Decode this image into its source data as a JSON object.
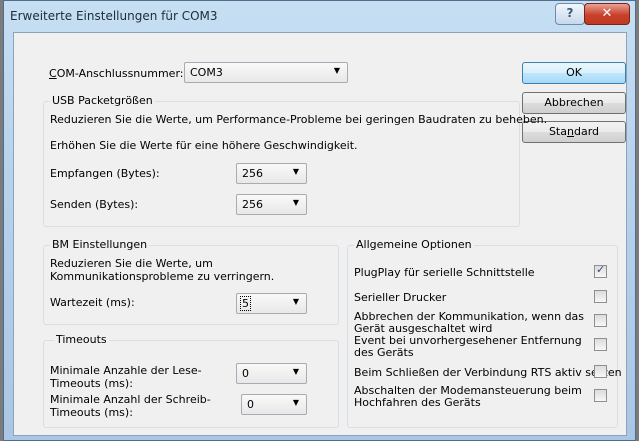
{
  "window": {
    "title": "Erweiterte Einstellungen für COM3",
    "help_label": "?",
    "close_label": "✕"
  },
  "com_port": {
    "label_prefix": "",
    "label_mnemonic": "C",
    "label_rest": "OM-Anschlussnummer:",
    "value": "COM3"
  },
  "buttons": {
    "ok": "OK",
    "cancel": "Abbrechen",
    "standard_prefix": "Sta",
    "standard_mnemonic": "n",
    "standard_rest": "dard"
  },
  "usb": {
    "group_label": "USB Packetgrößen",
    "desc1": "Reduzieren Sie die Werte, um Performance-Probleme bei geringen Baudraten zu beheben.",
    "desc2": "Erhöhen Sie die Werte für eine höhere Geschwindigkeit.",
    "receive_label": "Empfangen (Bytes):",
    "receive_value": "256",
    "send_label": "Senden (Bytes):",
    "send_value": "256"
  },
  "bm": {
    "group_label": "BM Einstellungen",
    "desc": "Reduzieren Sie die Werte, um Kommunikationsprobleme zu verringern.",
    "latency_label": "Wartezeit (ms):",
    "latency_value": "5"
  },
  "timeouts": {
    "group_label": "Timeouts",
    "read_label": "Minimale Anzahle der Lese-Timeouts (ms):",
    "read_value": "0",
    "write_label": "Minimale Anzahl der Schreib-Timeouts (ms):",
    "write_value": "0"
  },
  "options": {
    "group_label": "Allgemeine Optionen",
    "items": [
      {
        "label": "PlugPlay für serielle Schnittstelle",
        "checked": true
      },
      {
        "label": "Serieller Drucker",
        "checked": false
      },
      {
        "label": "Abbrechen der Kommunikation, wenn das Gerät ausgeschaltet wird",
        "checked": false
      },
      {
        "label": "Event bei unvorhergesehener Entfernung des Geräts",
        "checked": false
      },
      {
        "label": "Beim Schließen der Verbindung RTS aktiv setzen",
        "checked": false
      },
      {
        "label": "Abschalten der Modemansteuerung beim Hochfahren des Geräts",
        "checked": false
      }
    ]
  },
  "icons": {
    "dropdown_arrow": "▼",
    "check_mark": "✓"
  }
}
